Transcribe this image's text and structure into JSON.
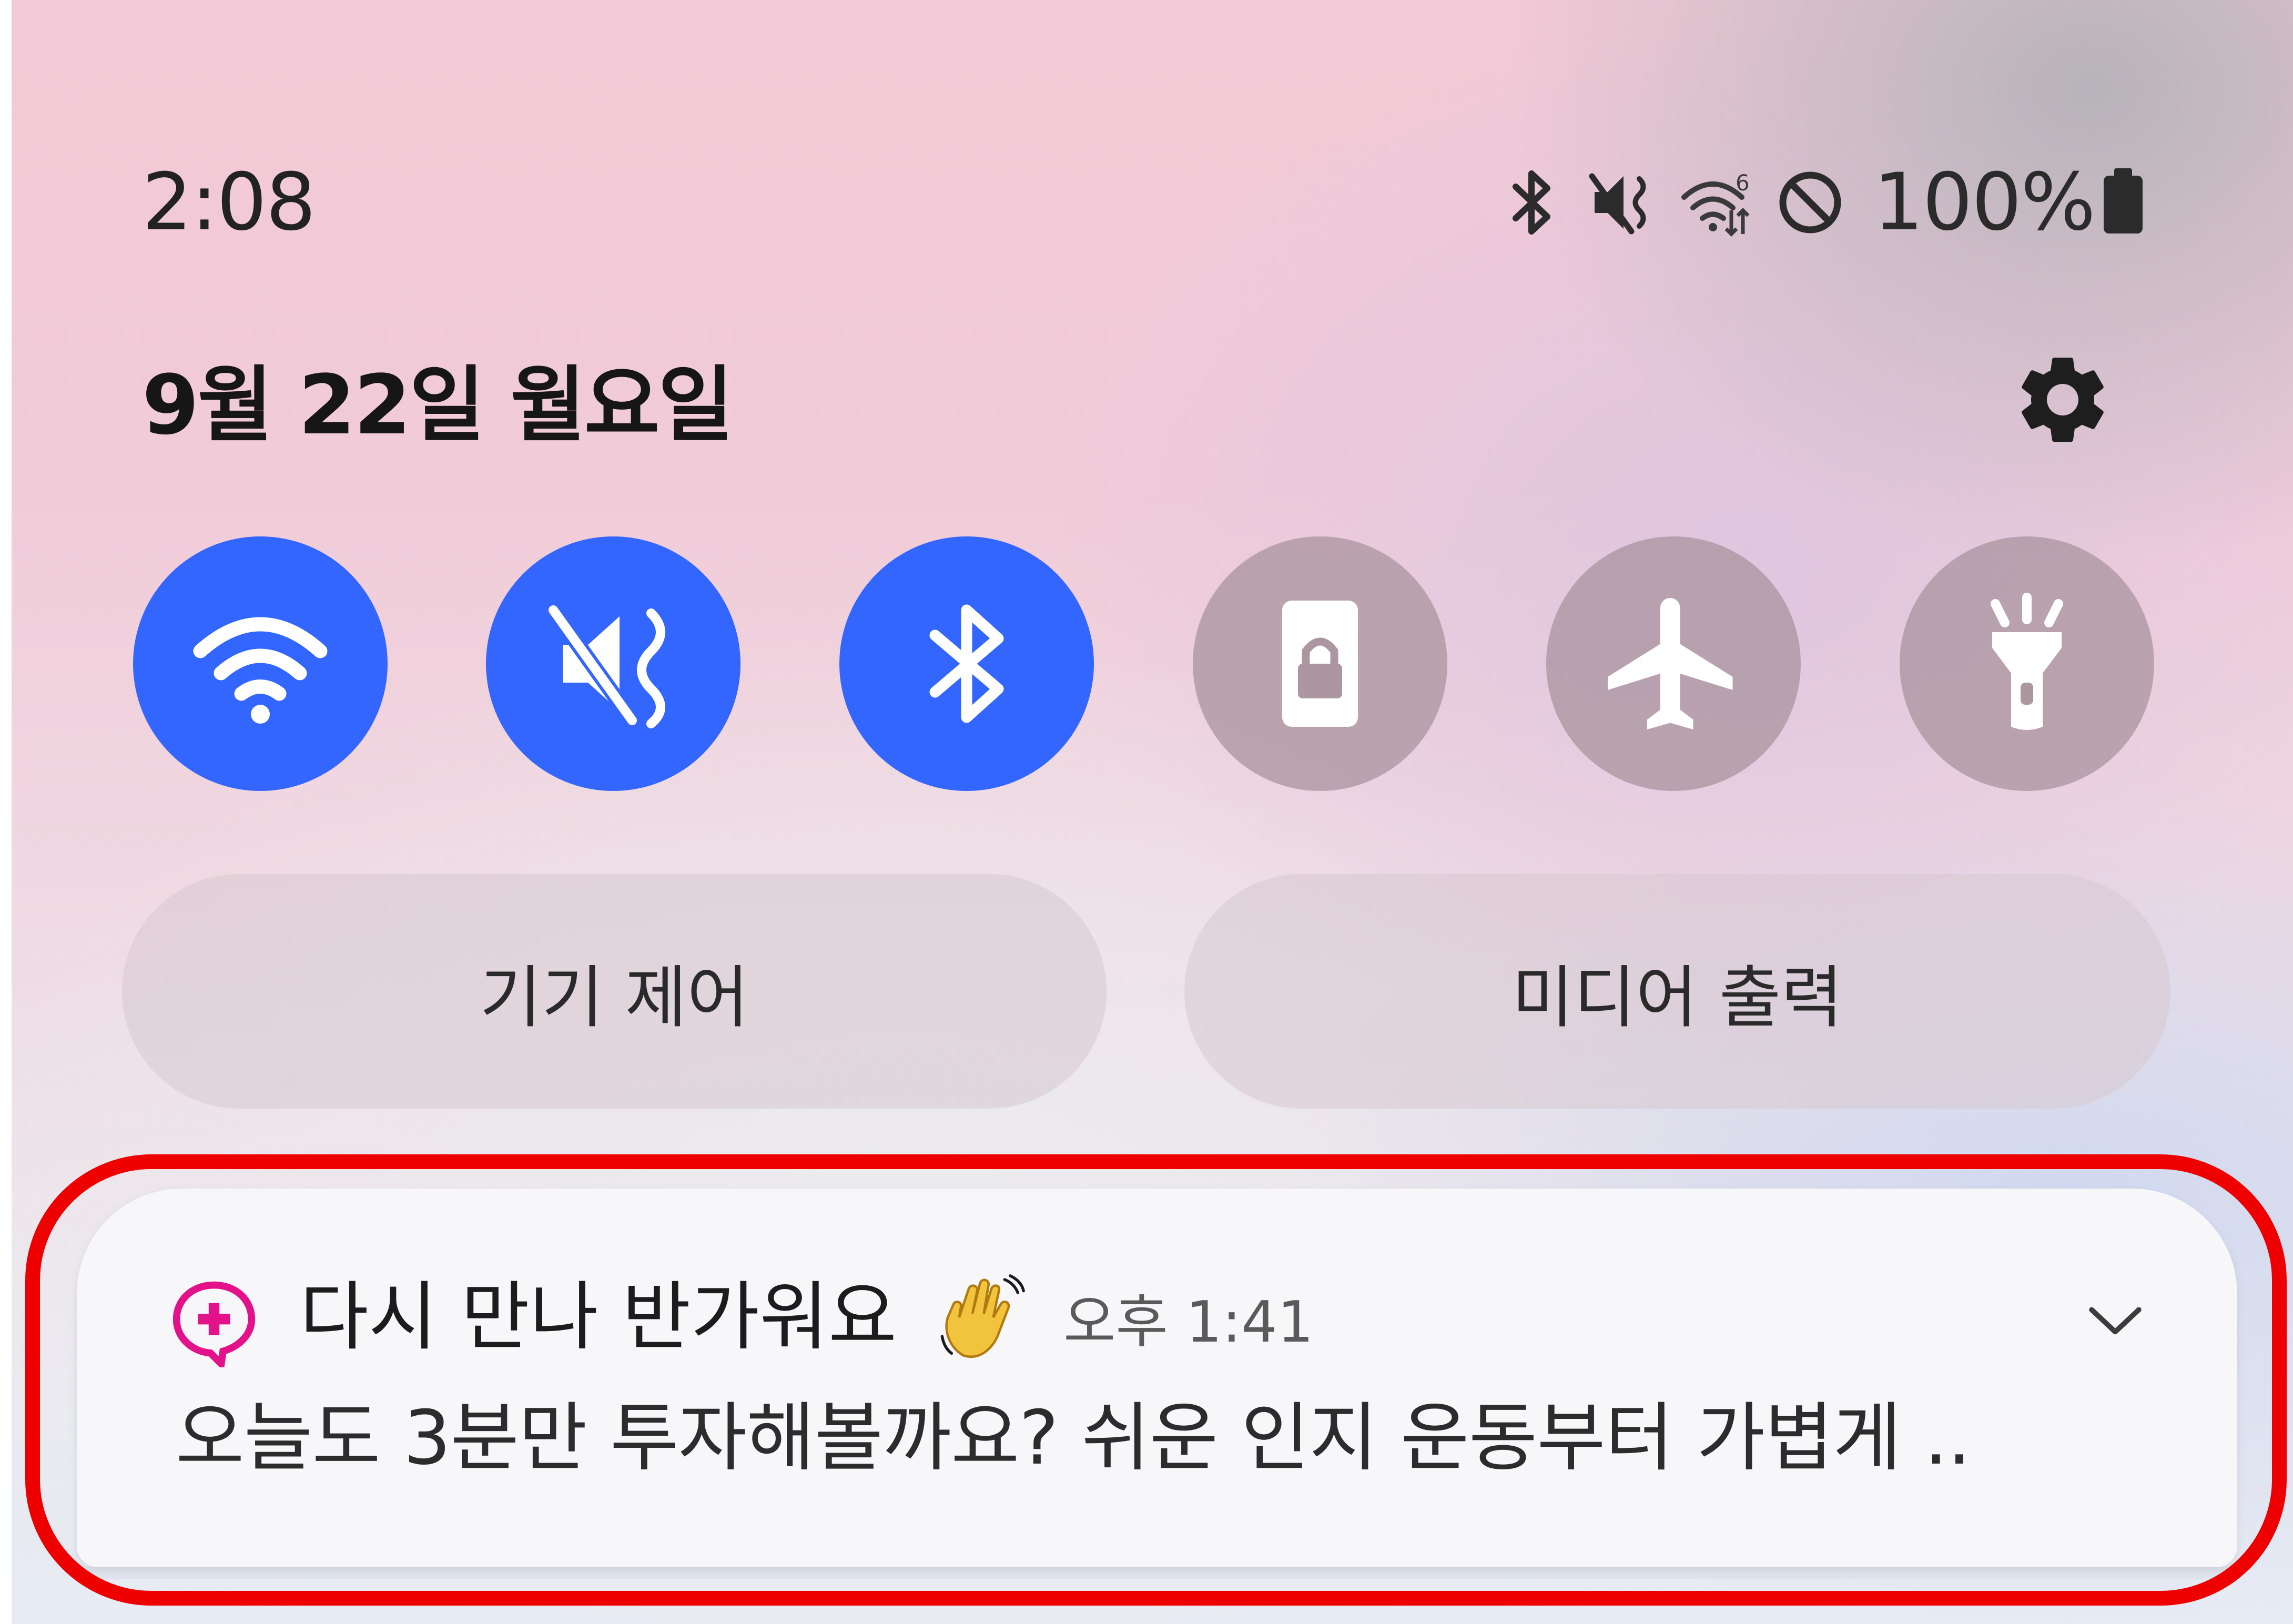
{
  "status_bar": {
    "time": "2:08",
    "battery": "100%",
    "icons": [
      "bluetooth-icon",
      "vibrate-mute-icon",
      "wifi-6-icon",
      "do-not-disturb-icon",
      "battery-icon"
    ]
  },
  "header": {
    "date": "9월 22일 월요일",
    "settings_icon": "gear-icon"
  },
  "quick_toggles": [
    {
      "name": "wifi",
      "icon": "wifi-icon",
      "state": "on"
    },
    {
      "name": "sound",
      "icon": "vibrate-mute-icon",
      "state": "on"
    },
    {
      "name": "bluetooth",
      "icon": "bluetooth-icon",
      "state": "on"
    },
    {
      "name": "rotation-lock",
      "icon": "portrait-lock-icon",
      "state": "off"
    },
    {
      "name": "airplane",
      "icon": "airplane-icon",
      "state": "off"
    },
    {
      "name": "flashlight",
      "icon": "flashlight-icon",
      "state": "off"
    }
  ],
  "pills": {
    "device_control": "기기 제어",
    "media_output": "미디어 출력"
  },
  "notification": {
    "title": "다시 만나 반가워요",
    "time": "오후 1:41",
    "body": "오늘도 3분만 투자해볼까요? 쉬운 인지 운동부터 가볍게 ..",
    "emoji": "waving-hand-emoji",
    "app_icon": "health-chat-icon"
  },
  "colors": {
    "toggle_on": "#3366ff",
    "toggle_off": "#ac96a0",
    "highlight": "#ee0000",
    "app_accent": "#e3128a"
  }
}
